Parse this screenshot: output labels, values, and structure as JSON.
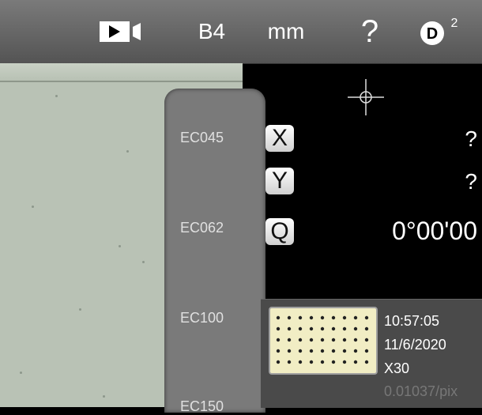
{
  "toolbar": {
    "video_icon": "video-camera-icon",
    "paper_size": "B4",
    "units": "mm",
    "help": "?",
    "d2_icon": "d2-icon",
    "d2_letter": "D",
    "d2_superscript": "2"
  },
  "ec_list": [
    {
      "label": "EC045"
    },
    {
      "label": "EC062"
    },
    {
      "label": "EC100"
    },
    {
      "label": "EC150"
    }
  ],
  "coords": {
    "x_label": "X",
    "x_value": "?",
    "y_label": "Y",
    "y_value": "?",
    "q_label": "Q",
    "q_value": "0°00'00"
  },
  "info": {
    "time": "10:57:05",
    "date": "11/6/2020",
    "zoom": "X30",
    "scale": "0.01037/pix"
  }
}
